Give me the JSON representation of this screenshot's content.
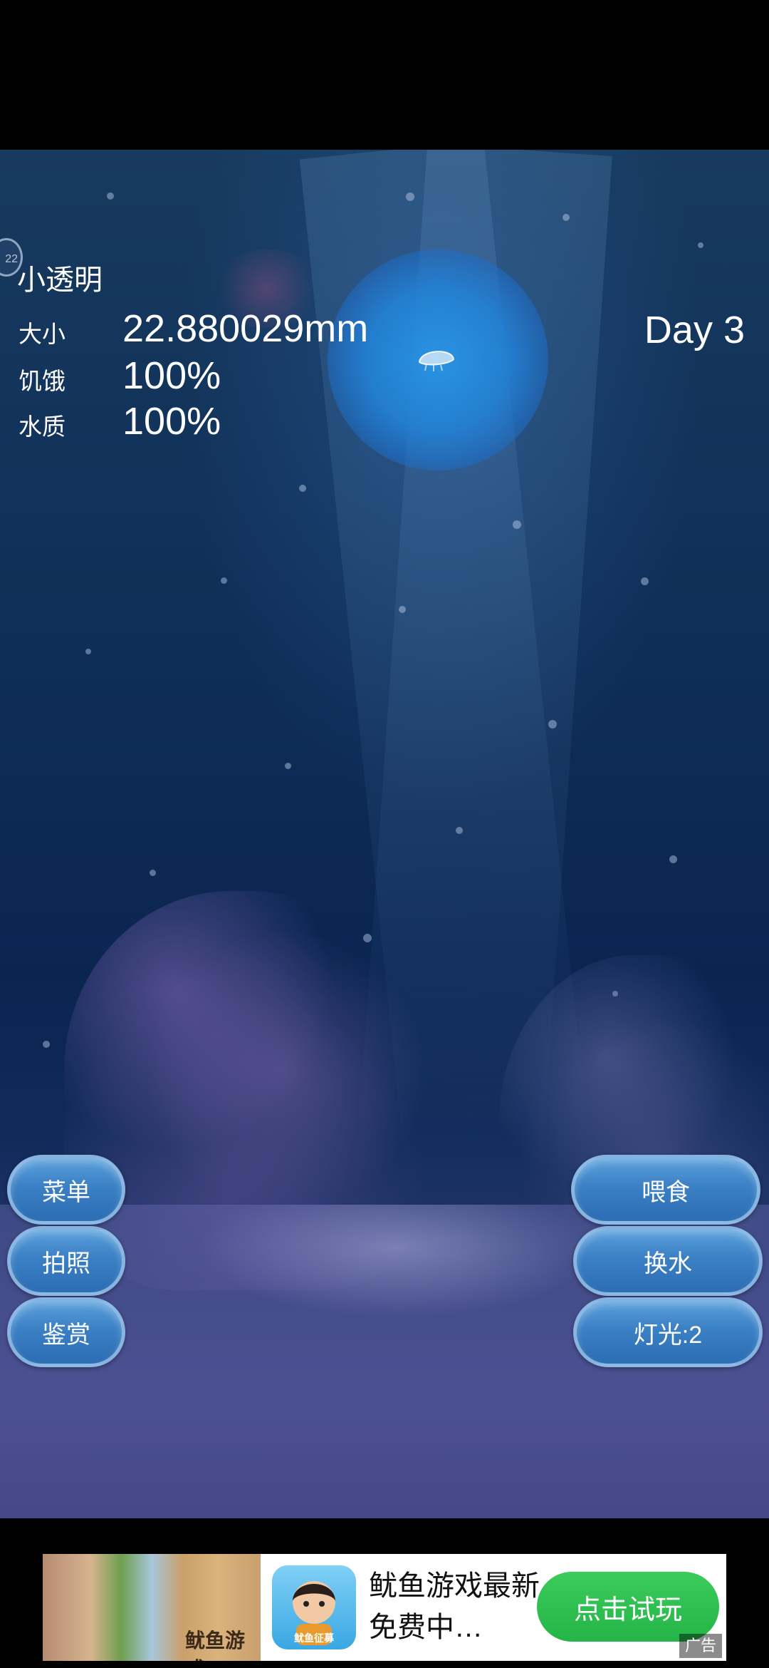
{
  "hud": {
    "badge": "22",
    "pet_name": "小透明",
    "day": "Day 3",
    "stats": {
      "size_label": "大小",
      "size_value": "22.880029mm",
      "hunger_label": "饥饿",
      "hunger_value": "100%",
      "water_label": "水质",
      "water_value": "100%"
    }
  },
  "buttons": {
    "menu": "菜单",
    "photo": "拍照",
    "appreciate": "鉴赏",
    "feed": "喂食",
    "change_water": "换水",
    "light": "灯光:2"
  },
  "ad": {
    "thumb_text": "鱿鱼游戏",
    "app_icon_label": "鱿鱼征募",
    "title": "鱿鱼游戏最新免费中…",
    "cta": "点击试玩",
    "tag": "广告"
  },
  "colors": {
    "button_fill": "#3b80c4",
    "cta_green": "#25b447",
    "water": "#0d2b55"
  }
}
